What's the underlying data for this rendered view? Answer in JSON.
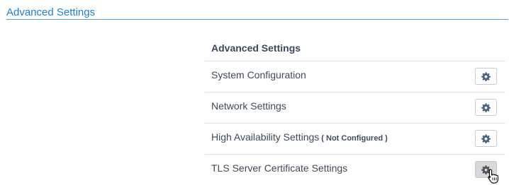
{
  "header": {
    "title": "Advanced Settings"
  },
  "panel": {
    "title": "Advanced Settings",
    "rows": [
      {
        "label": "System Configuration",
        "status": "",
        "button_icon": "gear-icon"
      },
      {
        "label": "Network Settings",
        "status": "",
        "button_icon": "gear-icon"
      },
      {
        "label": "High Availability Settings",
        "status": "( Not Configured )",
        "button_icon": "gear-icon"
      },
      {
        "label": "TLS Server Certificate Settings",
        "status": "",
        "button_icon": "gear-icon"
      }
    ]
  },
  "colors": {
    "title_blue": "#1f7fc8",
    "header_rule": "#5f9bc9",
    "text": "#3f4a57",
    "icon": "#4a6580",
    "hover_button": "#d9d9d9"
  }
}
